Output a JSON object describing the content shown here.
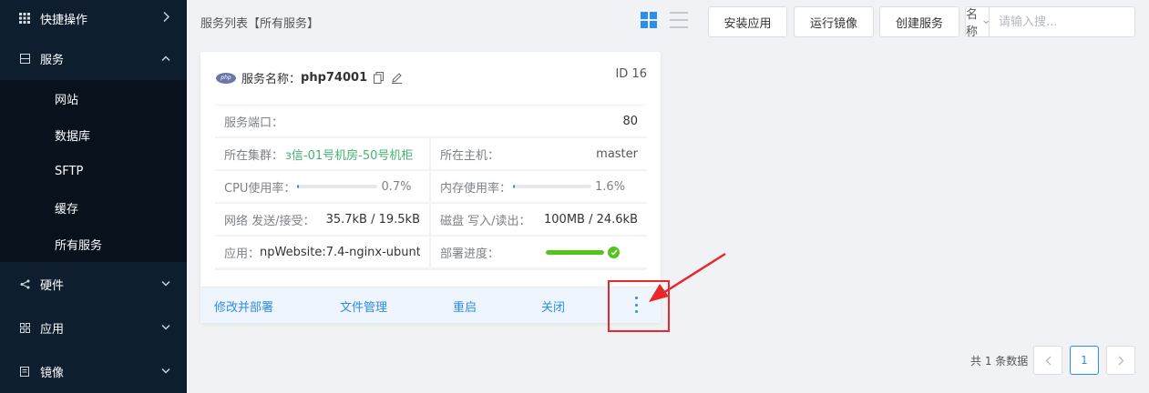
{
  "sidebar": {
    "quick_ops": "快捷操作",
    "services": "服务",
    "service_items": [
      "网站",
      "数据库",
      "SFTP",
      "缓存",
      "所有服务"
    ],
    "hardware": "硬件",
    "apps": "应用",
    "images": "镜像"
  },
  "header": {
    "breadcrumb": "服务列表【所有服务】",
    "install_app": "安装应用",
    "run_image": "运行镜像",
    "create_service": "创建服务",
    "search_field": "名称",
    "search_placeholder": "请输入搜..."
  },
  "card": {
    "service_prefix": "服务名称：",
    "service_name": "php74001",
    "id": "ID 16",
    "port_label": "服务端口：",
    "port_value": "80",
    "cluster_label": "所在集群：",
    "cluster_value": "з信-01号机房-50号机柜",
    "host_label": "所在主机：",
    "host_value": "master",
    "cpu_label": "CPU使用率：",
    "cpu_value": "0.7%",
    "cpu_fraction": 0.007,
    "mem_label": "内存使用率：",
    "mem_value": "1.6%",
    "mem_fraction": 0.016,
    "net_label": "网络 发送/接受：",
    "net_value": "35.7kB / 19.5kB",
    "disk_label": "磁盘 写入/读出：",
    "disk_value": "100MB / 24.6kB",
    "app_label": "应用：",
    "app_value": "npWebsite:7.4-nginx-ubuntu",
    "deploy_label": "部署进度：",
    "deploy_fraction": 1.0,
    "actions": [
      "修改并部署",
      "文件管理",
      "重启",
      "关闭"
    ]
  },
  "pagination": {
    "total": "共 1 条数据",
    "current": "1"
  },
  "colors": {
    "sidebar_bg": "#0e1e2f",
    "accent": "#2d8cf0",
    "success": "#52c41a",
    "highlight": "#e8282b"
  }
}
